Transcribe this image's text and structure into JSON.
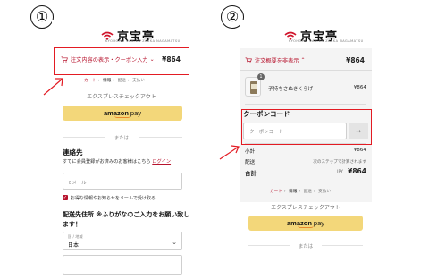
{
  "step_labels": {
    "first": "①",
    "second": "②"
  },
  "brand": {
    "name": "京宝亭",
    "tagline": "KYOHOTEI SAN-EN ZAKKA NAGAMATSU"
  },
  "left": {
    "summary_toggle": "注文内容の表示・クーポン入力",
    "summary_total": "¥864",
    "breadcrumb": [
      "カート",
      "情報",
      "配送",
      "支払い"
    ],
    "express_checkout": "エクスプレスチェックアウト",
    "amazon_pay": {
      "amazon": "amazon",
      "pay": "pay"
    },
    "or_text": "または",
    "contact": {
      "heading": "連絡先",
      "already_account": "すでに会員登録がお済みのお客様はこちら",
      "login_link": "ログイン",
      "email_placeholder": "Eメール",
      "newsletter_label": "お得な情報やお知らせをメールで受け取る",
      "newsletter_checked": "✓"
    },
    "shipping": {
      "heading_line1": "配送先住所 ※ふりがなのご入力をお願い致し",
      "heading_line2": "ます！",
      "country_label": "国 / 地域",
      "country_value": "日本",
      "chevron": "⌄"
    }
  },
  "right": {
    "summary_toggle": "注文概要を非表示",
    "summary_total": "¥864",
    "item": {
      "quantity": "1",
      "name": "子持ちさぬきくらげ",
      "price": "¥864"
    },
    "coupon": {
      "heading": "クーポンコード",
      "placeholder": "クーポンコード",
      "apply_arrow": "→"
    },
    "subtotal": {
      "label": "小計",
      "value": "¥864"
    },
    "shipping": {
      "label": "配送",
      "note": "次のステップで計算されます"
    },
    "total": {
      "label": "合計",
      "currency": "JPY",
      "value": "¥864"
    },
    "breadcrumb": [
      "カート",
      "情報",
      "配送",
      "支払い"
    ],
    "express_checkout": "エクスプレスチェックアウト",
    "amazon_pay": {
      "amazon": "amazon",
      "pay": "pay"
    },
    "or_text": "または"
  },
  "colors": {
    "accent": "#b7132d",
    "highlight": "#e31b23",
    "amazon_button": "#f3d77a"
  }
}
